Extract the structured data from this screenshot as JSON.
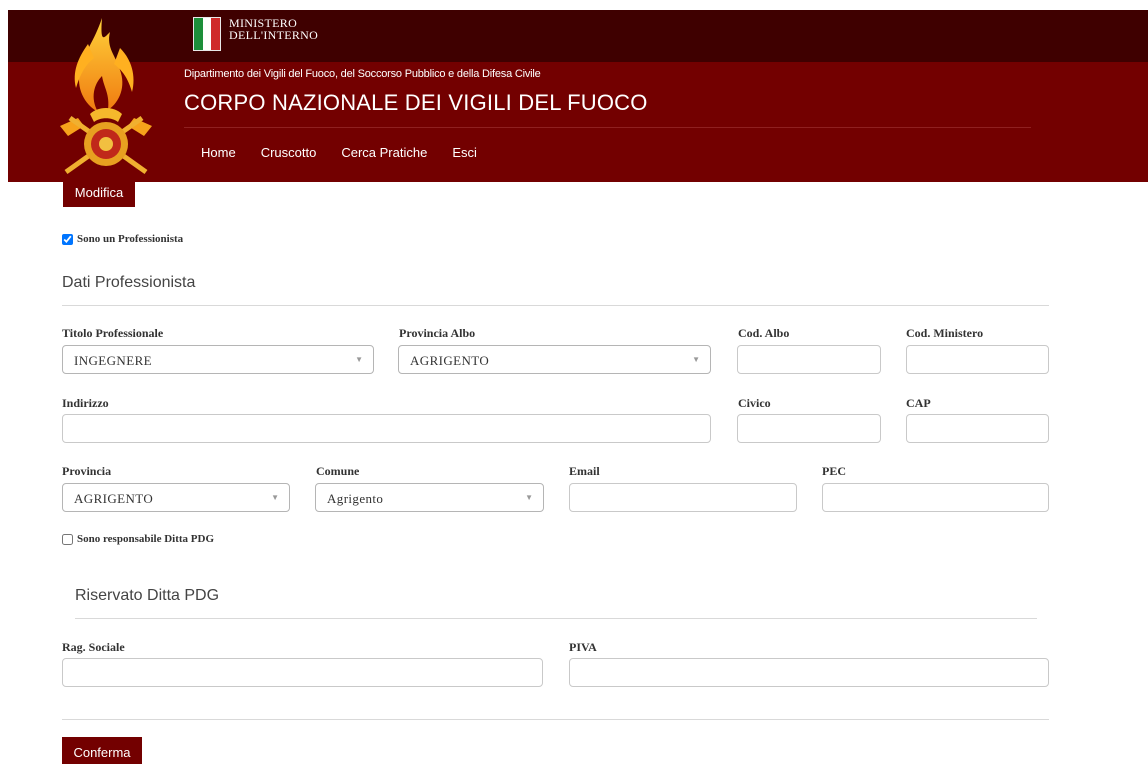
{
  "header": {
    "ministry_line1": "MINISTERO",
    "ministry_line2": "DELL'INTERNO",
    "department": "Dipartimento dei Vigili del Fuoco, del Soccorso Pubblico e della Difesa Civile",
    "title": "CORPO NAZIONALE DEI VIGILI DEL FUOCO",
    "nav": [
      "Home",
      "Cruscotto",
      "Cerca Pratiche",
      "Esci"
    ]
  },
  "tab": {
    "label": "Modifica"
  },
  "professionista": {
    "checkbox_label": "Sono un Professionista",
    "checked": true,
    "section_title": "Dati Professionista",
    "labels": {
      "titolo": "Titolo Professionale",
      "provincia_albo": "Provincia Albo",
      "cod_albo": "Cod. Albo",
      "cod_ministero": "Cod. Ministero",
      "indirizzo": "Indirizzo",
      "civico": "Civico",
      "cap": "CAP",
      "provincia": "Provincia",
      "comune": "Comune",
      "email": "Email",
      "pec": "PEC"
    },
    "values": {
      "titolo": "INGEGNERE",
      "provincia_albo": "AGRIGENTO",
      "provincia": "AGRIGENTO",
      "comune": "Agrigento"
    }
  },
  "ditta": {
    "checkbox_label": "Sono responsabile Ditta PDG",
    "checked": false,
    "section_title": "Riservato Ditta PDG",
    "labels": {
      "rag_sociale": "Rag. Sociale",
      "piva": "PIVA"
    }
  },
  "submit_label": "Conferma",
  "colors": {
    "header_dark": "#3f0000",
    "header": "#730000",
    "accent": "#730000"
  },
  "icons": {
    "logo": "firefighters-flame-emblem-icon",
    "flag": "italian-flag-icon"
  }
}
